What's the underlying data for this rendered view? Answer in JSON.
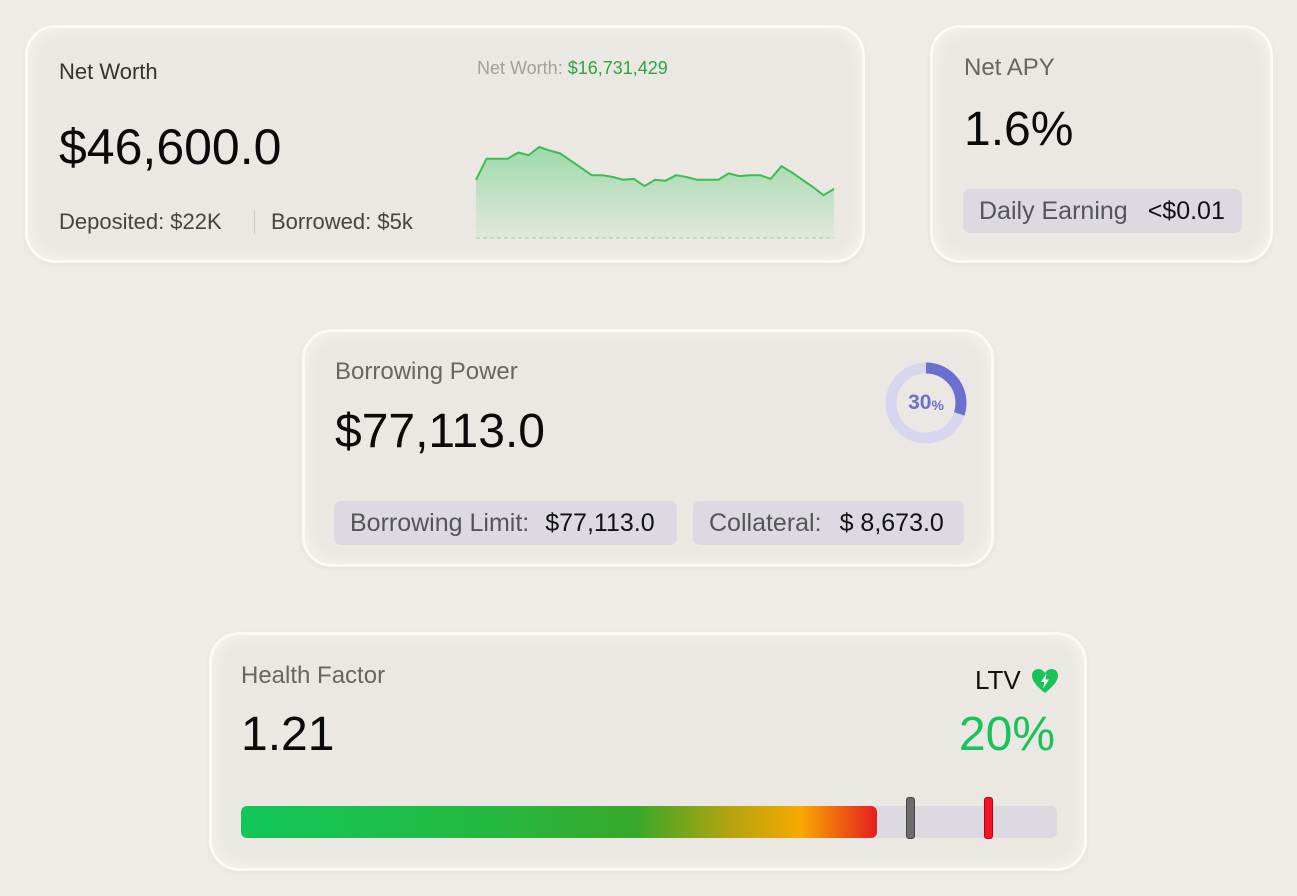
{
  "net_worth": {
    "title": "Net Worth",
    "value": "$46,600.0",
    "deposited": "Deposited: $22K",
    "borrowed": "Borrowed: $5k",
    "chart_label_key": "Net Worth:",
    "chart_label_value": "$16,731,429"
  },
  "net_apy": {
    "title": "Net APY",
    "value": "1.6%",
    "daily_earning_label": "Daily Earning",
    "daily_earning_value": "<$0.01"
  },
  "borrowing_power": {
    "title": "Borrowing Power",
    "value": "$77,113.0",
    "usage_number": "30",
    "usage_unit": "%",
    "usage_fraction": 0.3,
    "limit_label": "Borrowing Limit:",
    "limit_value": "$77,113.0",
    "collateral_label": "Collateral:",
    "collateral_value": "$ 8,673.0"
  },
  "health_factor": {
    "title": "Health Factor",
    "value": "1.21",
    "ltv_label": "LTV",
    "ltv_icon": "heart-bolt-icon",
    "ltv_value": "20%",
    "bar_fill_fraction": 0.78,
    "marker_gray_fraction": 0.82,
    "marker_red_fraction": 0.915
  },
  "colors": {
    "accent_green": "#19c25b",
    "chart_green": "#3dbb55",
    "donut_blue": "#6b6fd0",
    "danger_red": "#ee1526"
  },
  "chart_data": {
    "type": "area",
    "series": [
      {
        "values": [
          0.64,
          0.87,
          0.87,
          0.87,
          0.94,
          0.91,
          1.0,
          0.96,
          0.93,
          0.85,
          0.77,
          0.69,
          0.69,
          0.67,
          0.64,
          0.65,
          0.57,
          0.64,
          0.63,
          0.69,
          0.67,
          0.64,
          0.64,
          0.64,
          0.71,
          0.68,
          0.69,
          0.69,
          0.65,
          0.79,
          0.72,
          0.64,
          0.56,
          0.47,
          0.54
        ]
      }
    ],
    "ylim": [
      0,
      1
    ],
    "grid": false,
    "legend": "none"
  }
}
